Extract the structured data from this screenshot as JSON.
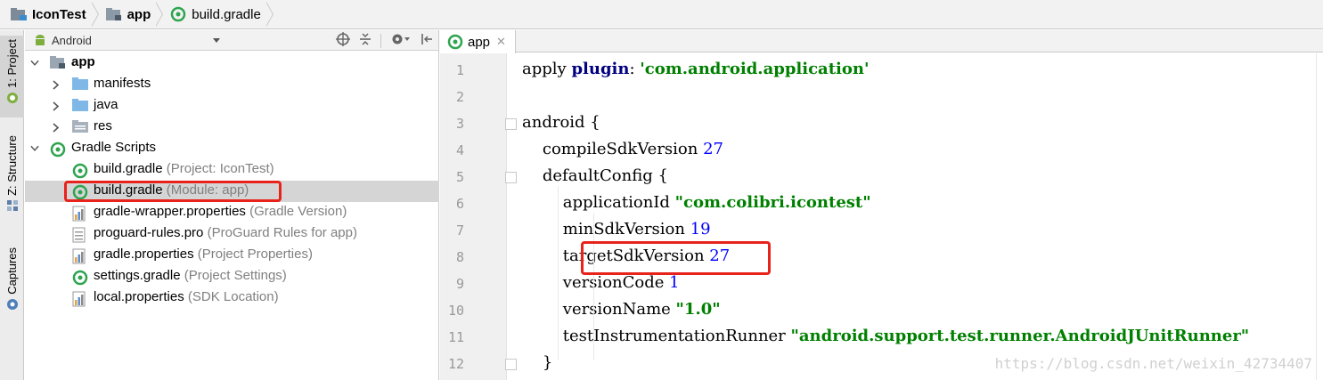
{
  "breadcrumb": {
    "items": [
      {
        "label": "IconTest",
        "icon": "project-folder-icon"
      },
      {
        "label": "app",
        "icon": "module-folder-icon"
      },
      {
        "label": "build.gradle",
        "icon": "gradle-icon"
      }
    ]
  },
  "toolstrip": {
    "tabs": [
      "1: Project",
      "Z: Structure",
      "Captures"
    ]
  },
  "project_panel": {
    "view_selector": "Android",
    "tree": [
      {
        "label": "app",
        "hint": "",
        "bold": true,
        "depth": 0,
        "expanded": true,
        "icon": "module-folder-icon"
      },
      {
        "label": "manifests",
        "hint": "",
        "depth": 1,
        "expanded": false,
        "icon": "folder-icon"
      },
      {
        "label": "java",
        "hint": "",
        "depth": 1,
        "expanded": false,
        "icon": "folder-icon"
      },
      {
        "label": "res",
        "hint": "",
        "depth": 1,
        "expanded": false,
        "icon": "res-folder-icon"
      },
      {
        "label": "Gradle Scripts",
        "hint": "",
        "depth": 0,
        "expanded": true,
        "icon": "gradle-icon"
      },
      {
        "label": "build.gradle",
        "hint": "(Project: IconTest)",
        "depth": 1,
        "icon": "gradle-icon"
      },
      {
        "label": "build.gradle",
        "hint": "(Module: app)",
        "depth": 1,
        "icon": "gradle-icon",
        "selected": true
      },
      {
        "label": "gradle-wrapper.properties",
        "hint": "(Gradle Version)",
        "depth": 1,
        "icon": "properties-icon"
      },
      {
        "label": "proguard-rules.pro",
        "hint": "(ProGuard Rules for app)",
        "depth": 1,
        "icon": "file-icon"
      },
      {
        "label": "gradle.properties",
        "hint": "(Project Properties)",
        "depth": 1,
        "icon": "properties-icon"
      },
      {
        "label": "settings.gradle",
        "hint": "(Project Settings)",
        "depth": 1,
        "icon": "gradle-icon"
      },
      {
        "label": "local.properties",
        "hint": "(SDK Location)",
        "depth": 1,
        "icon": "properties-icon"
      }
    ]
  },
  "editor": {
    "tab_label": "app",
    "lines": [
      {
        "n": "1",
        "parts": [
          [
            "t",
            "apply "
          ],
          [
            "kw",
            "plugin"
          ],
          [
            "t",
            ": "
          ],
          [
            "str",
            "'com.android.application'"
          ]
        ]
      },
      {
        "n": "2",
        "parts": []
      },
      {
        "n": "3",
        "parts": [
          [
            "t",
            "android {"
          ]
        ]
      },
      {
        "n": "4",
        "parts": [
          [
            "t",
            "    compileSdkVersion "
          ],
          [
            "num",
            "27"
          ]
        ]
      },
      {
        "n": "5",
        "parts": [
          [
            "t",
            "    defaultConfig {"
          ]
        ]
      },
      {
        "n": "6",
        "parts": [
          [
            "t",
            "        applicationId "
          ],
          [
            "str",
            "\"com.colibri.icontest\""
          ]
        ]
      },
      {
        "n": "7",
        "parts": [
          [
            "t",
            "        minSdkVersion "
          ],
          [
            "num",
            "19"
          ]
        ]
      },
      {
        "n": "8",
        "parts": [
          [
            "t",
            "        targetSdkVersion "
          ],
          [
            "num",
            "27"
          ]
        ]
      },
      {
        "n": "9",
        "parts": [
          [
            "t",
            "        versionCode "
          ],
          [
            "num",
            "1"
          ]
        ]
      },
      {
        "n": "10",
        "parts": [
          [
            "t",
            "        versionName "
          ],
          [
            "str",
            "\"1.0\""
          ]
        ]
      },
      {
        "n": "11",
        "parts": [
          [
            "t",
            "        testInstrumentationRunner "
          ],
          [
            "str",
            "\"android.support.test.runner.AndroidJUnitRunner\""
          ]
        ]
      },
      {
        "n": "12",
        "parts": [
          [
            "t",
            "    }"
          ]
        ]
      }
    ]
  },
  "watermark": "https://blog.csdn.net/weixin_42734407",
  "colors": {
    "highlight": "#e8231c",
    "keyword": "#000080",
    "string": "#008000",
    "number": "#0000ff",
    "hint": "#808080",
    "gradle": "#2ea44f"
  }
}
